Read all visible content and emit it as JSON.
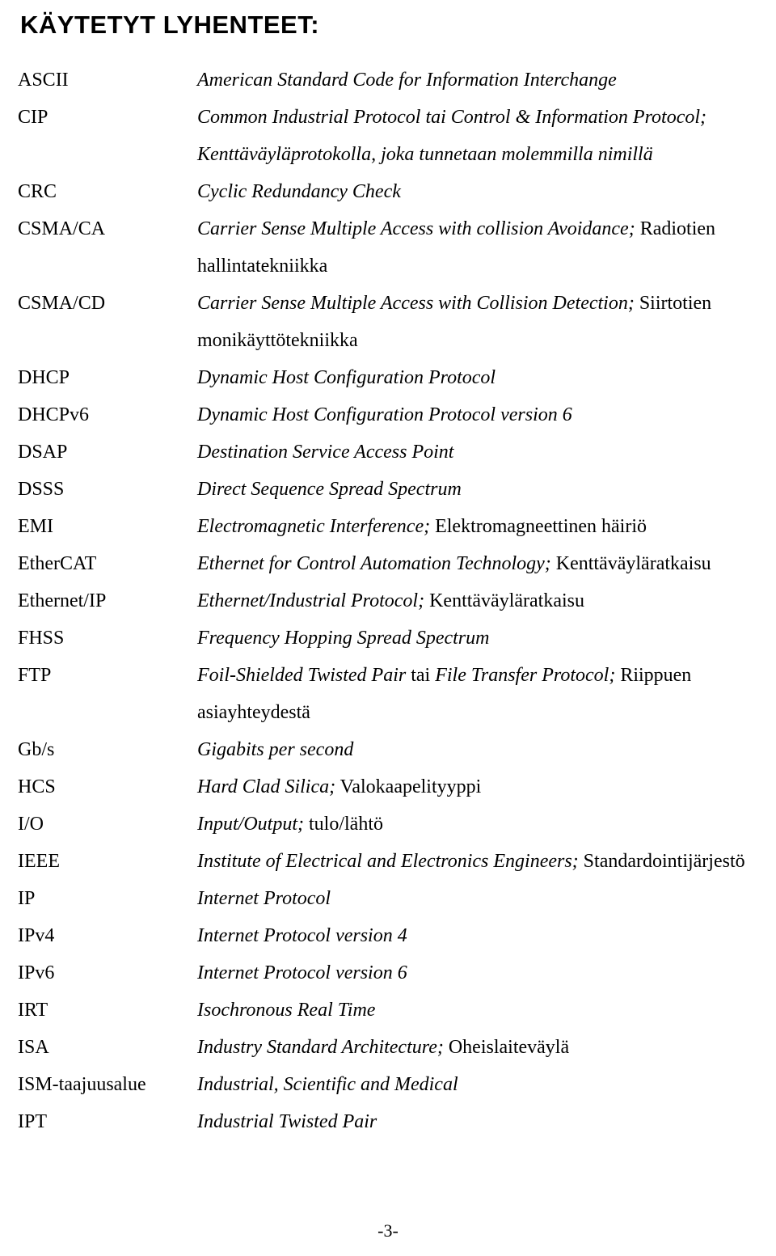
{
  "document": {
    "title": "KÄYTETYT LYHENTEET:",
    "page_number": "-3-"
  },
  "abbreviations": [
    {
      "term": "ASCII",
      "parts": [
        {
          "text": "American Standard Code for Information Interchange",
          "style": "italic"
        }
      ]
    },
    {
      "term": "CIP",
      "parts": [
        {
          "text": "Common Industrial Protocol tai Control & Information Protocol;",
          "style": "italic"
        },
        {
          "text": " ",
          "style": "italic"
        },
        {
          "text": "Kenttäväyläprotokolla, joka tunnetaan molemmilla nimillä",
          "style": "italic"
        }
      ]
    },
    {
      "term": "CRC",
      "parts": [
        {
          "text": "Cyclic Redundancy Check",
          "style": "italic"
        }
      ]
    },
    {
      "term": "CSMA/CA",
      "parts": [
        {
          "text": "Carrier Sense Multiple Access with collision Avoidance;",
          "style": "italic"
        },
        {
          "text": " Radiotien hallintatekniikka",
          "style": "roman"
        }
      ]
    },
    {
      "term": "CSMA/CD",
      "parts": [
        {
          "text": "Carrier Sense Multiple Access with Collision Detection;",
          "style": "italic"
        },
        {
          "text": " Siirtotien monikäyttötekniikka",
          "style": "roman"
        }
      ]
    },
    {
      "term": "DHCP",
      "parts": [
        {
          "text": "Dynamic Host Configuration Protocol",
          "style": "italic"
        }
      ]
    },
    {
      "term": "DHCPv6",
      "parts": [
        {
          "text": "Dynamic Host Configuration Protocol version 6",
          "style": "italic"
        }
      ]
    },
    {
      "term": "DSAP",
      "parts": [
        {
          "text": "Destination Service Access Point",
          "style": "italic"
        }
      ]
    },
    {
      "term": "DSSS",
      "parts": [
        {
          "text": "Direct Sequence Spread Spectrum",
          "style": "italic"
        }
      ]
    },
    {
      "term": "EMI",
      "parts": [
        {
          "text": "Electromagnetic Interference;",
          "style": "italic"
        },
        {
          "text": " Elektromagneettinen häiriö",
          "style": "roman"
        }
      ]
    },
    {
      "term": "EtherCAT",
      "parts": [
        {
          "text": "Ethernet for Control Automation Technology;",
          "style": "italic"
        },
        {
          "text": " Kenttäväyläratkaisu",
          "style": "roman"
        }
      ]
    },
    {
      "term": "Ethernet/IP",
      "parts": [
        {
          "text": "Ethernet/Industrial Protocol;",
          "style": "italic"
        },
        {
          "text": " Kenttäväyläratkaisu",
          "style": "roman"
        }
      ]
    },
    {
      "term": "FHSS",
      "parts": [
        {
          "text": "Frequency Hopping Spread Spectrum",
          "style": "italic"
        }
      ]
    },
    {
      "term": "FTP",
      "parts": [
        {
          "text": "Foil-Shielded Twisted Pair",
          "style": "italic"
        },
        {
          "text": " tai ",
          "style": "roman"
        },
        {
          "text": "File Transfer Protocol;",
          "style": "italic"
        },
        {
          "text": " Riippuen asiayhteydestä",
          "style": "roman"
        }
      ]
    },
    {
      "term": "Gb/s",
      "parts": [
        {
          "text": "Gigabits per second",
          "style": "italic"
        }
      ]
    },
    {
      "term": "HCS",
      "parts": [
        {
          "text": "Hard Clad Silica;",
          "style": "italic"
        },
        {
          "text": " Valokaapelityyppi",
          "style": "roman"
        }
      ]
    },
    {
      "term": "I/O",
      "parts": [
        {
          "text": "Input/Output;",
          "style": "italic"
        },
        {
          "text": " tulo/lähtö",
          "style": "roman"
        }
      ]
    },
    {
      "term": "IEEE",
      "parts": [
        {
          "text": "Institute of Electrical and Electronics Engineers;",
          "style": "italic"
        },
        {
          "text": " Standardointijärjestö",
          "style": "roman"
        }
      ]
    },
    {
      "term": "IP",
      "parts": [
        {
          "text": "Internet Protocol",
          "style": "italic"
        }
      ]
    },
    {
      "term": "IPv4",
      "parts": [
        {
          "text": "Internet Protocol version 4",
          "style": "italic"
        }
      ]
    },
    {
      "term": "IPv6",
      "parts": [
        {
          "text": "Internet Protocol version 6",
          "style": "italic"
        }
      ]
    },
    {
      "term": "IRT",
      "parts": [
        {
          "text": "Isochronous Real Time",
          "style": "italic"
        }
      ]
    },
    {
      "term": "ISA",
      "parts": [
        {
          "text": "Industry Standard Architecture;",
          "style": "italic"
        },
        {
          "text": " Oheislaiteväylä",
          "style": "roman"
        }
      ]
    },
    {
      "term": "ISM-taajuusalue",
      "parts": [
        {
          "text": "Industrial, Scientific and Medical",
          "style": "italic"
        }
      ]
    },
    {
      "term": "IPT",
      "parts": [
        {
          "text": "Industrial Twisted Pair",
          "style": "italic"
        }
      ]
    }
  ]
}
